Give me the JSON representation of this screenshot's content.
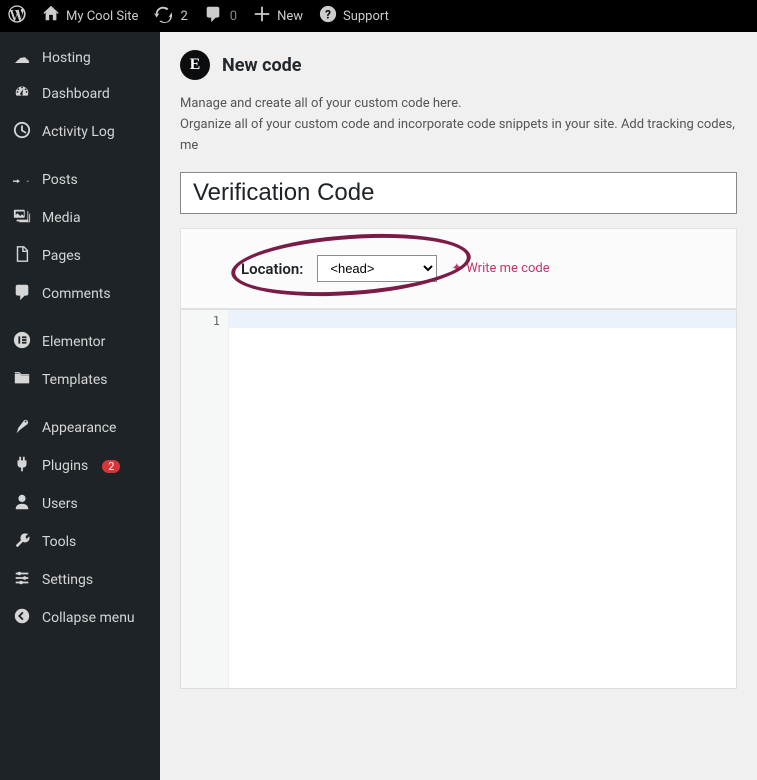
{
  "adminbar": {
    "site_name": "My Cool Site",
    "updates_count": "2",
    "comments_count": "0",
    "new_label": "New",
    "support_label": "Support"
  },
  "sidebar": {
    "items": [
      {
        "label": "Hosting",
        "icon": "cloud"
      },
      {
        "label": "Dashboard",
        "icon": "dash"
      },
      {
        "label": "Activity Log",
        "icon": "clock"
      },
      {
        "label": "Posts",
        "icon": "pin"
      },
      {
        "label": "Media",
        "icon": "media"
      },
      {
        "label": "Pages",
        "icon": "page"
      },
      {
        "label": "Comments",
        "icon": "comment"
      },
      {
        "label": "Elementor",
        "icon": "elementor"
      },
      {
        "label": "Templates",
        "icon": "folder"
      },
      {
        "label": "Appearance",
        "icon": "brush"
      },
      {
        "label": "Plugins",
        "icon": "plug",
        "badge": "2"
      },
      {
        "label": "Users",
        "icon": "user"
      },
      {
        "label": "Tools",
        "icon": "wrench"
      },
      {
        "label": "Settings",
        "icon": "sliders"
      },
      {
        "label": "Collapse menu",
        "icon": "collapse"
      }
    ]
  },
  "page": {
    "title": "New code",
    "intro_1": "Manage and create all of your custom code here.",
    "intro_2": "Organize all of your custom code and incorporate code snippets in your site. Add tracking codes, me",
    "code_title": "Verification Code",
    "location_label": "Location:",
    "location_value": "<head>",
    "write_me": "Write me code",
    "line_num": "1"
  },
  "colors": {
    "accent": "#c9356e",
    "annot": "#7a1c47"
  }
}
